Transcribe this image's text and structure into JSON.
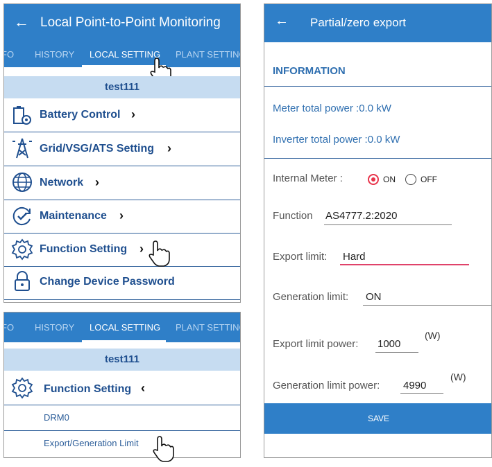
{
  "top_left": {
    "title": "Local Point-to-Point Monitoring",
    "tabs": [
      "FO",
      "HISTORY",
      "LOCAL SETTING",
      "PLANT SETTING"
    ],
    "active_tab": "LOCAL SETTING",
    "device": "test111",
    "menu": [
      {
        "label": "Battery Control",
        "icon": "battery-gear-icon"
      },
      {
        "label": "Grid/VSG/ATS Setting",
        "icon": "grid-tower-icon"
      },
      {
        "label": "Network",
        "icon": "globe-icon"
      },
      {
        "label": "Maintenance",
        "icon": "refresh-check-icon"
      },
      {
        "label": "Function Setting",
        "icon": "gear-icon"
      },
      {
        "label": "Change Device Password",
        "icon": "lock-icon"
      }
    ]
  },
  "bottom_left": {
    "tabs": [
      "FO",
      "HISTORY",
      "LOCAL SETTING",
      "PLANT SETTING"
    ],
    "device": "test111",
    "expanded_item": "Function Setting",
    "sub_items": [
      "DRM0",
      "Export/Generation Limit"
    ]
  },
  "right": {
    "title": "Partial/zero export",
    "section_heading": "INFORMATION",
    "meter_total_power": "Meter total power :0.0 kW",
    "inverter_total_power": "Inverter total power :0.0 kW",
    "internal_meter_label": "Internal Meter :",
    "internal_meter_on": "ON",
    "internal_meter_off": "OFF",
    "function_label": "Function",
    "function_value": "AS4777.2:2020",
    "export_limit_label": "Export limit:",
    "export_limit_value": "Hard",
    "generation_limit_label": "Generation limit:",
    "generation_limit_value": "ON",
    "export_limit_power_label": "Export limit power:",
    "export_limit_power_value": "1000",
    "export_limit_power_unit": "(W)",
    "generation_limit_power_label": "Generation limit power:",
    "generation_limit_power_value": "4990",
    "generation_limit_power_unit": "(W)",
    "save_button": "SAVE"
  },
  "colors": {
    "header_blue": "#2f7fc8",
    "device_bar": "#c6dcf1",
    "text_navy": "#1f4f8f",
    "radio_red": "#e8334a",
    "export_underline": "#e0436a"
  }
}
